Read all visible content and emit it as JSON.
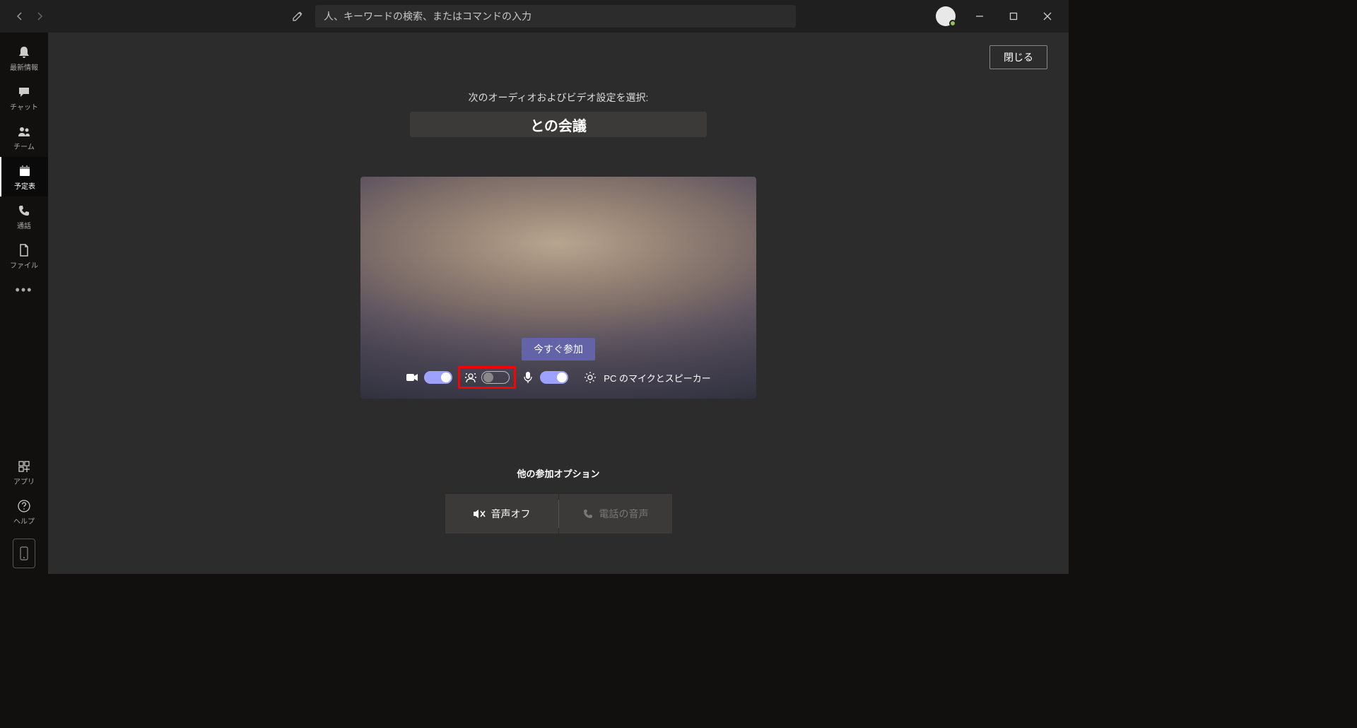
{
  "titlebar": {
    "search_placeholder": "人、キーワードの検索、またはコマンドの入力"
  },
  "rail": {
    "items": [
      {
        "id": "activity",
        "label": "最新情報"
      },
      {
        "id": "chat",
        "label": "チャット"
      },
      {
        "id": "teams",
        "label": "チーム"
      },
      {
        "id": "calendar",
        "label": "予定表"
      },
      {
        "id": "calls",
        "label": "通話"
      },
      {
        "id": "files",
        "label": "ファイル"
      }
    ],
    "bottom": [
      {
        "id": "apps",
        "label": "アプリ"
      },
      {
        "id": "help",
        "label": "ヘルプ"
      }
    ]
  },
  "main": {
    "close_label": "閉じる",
    "settings_label": "次のオーディオおよびビデオ設定を選択:",
    "meeting_title": "との会議",
    "join_label": "今すぐ参加",
    "device_label": "PC のマイクとスピーカー",
    "other_options_label": "他の参加オプション",
    "audio_off_label": "音声オフ",
    "phone_audio_label": "電話の音声"
  }
}
